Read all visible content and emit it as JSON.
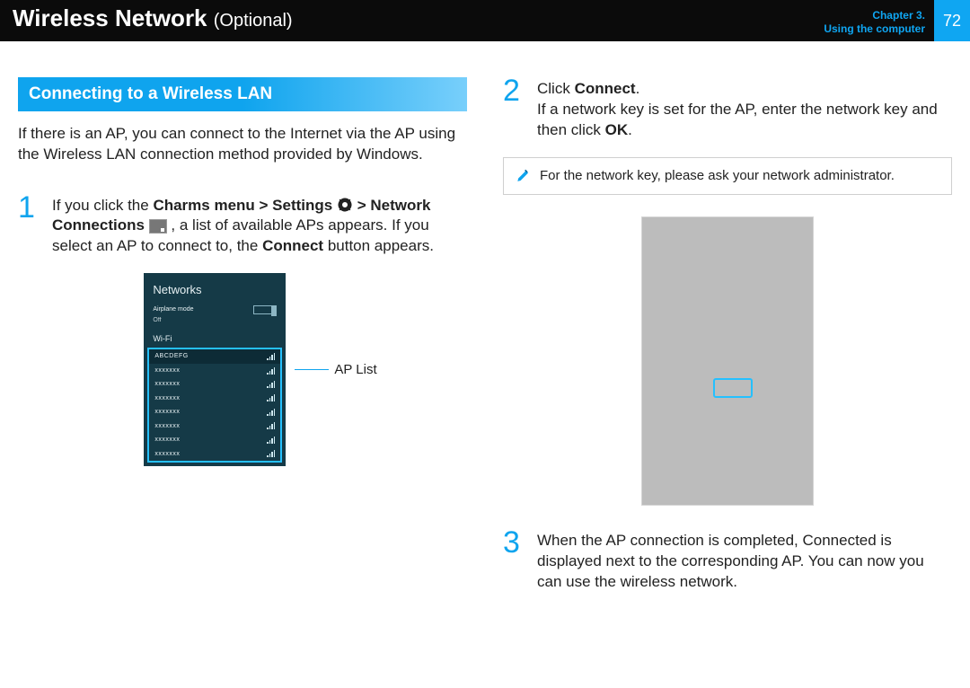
{
  "header": {
    "title_strong": "Wireless Network",
    "title_tag": "(Optional)",
    "chapter_line1": "Chapter 3.",
    "chapter_line2": "Using the computer",
    "page_number": "72"
  },
  "left": {
    "section_heading": "Connecting to a Wireless LAN",
    "intro": "If there is an AP, you can connect to the Internet via the AP using the Wireless LAN connection method provided by Windows.",
    "step1": {
      "num": "1",
      "text_a": "If you click the ",
      "bold_a": "Charms menu > Settings",
      "settings_icon_name": "settings-gear-icon",
      "bold_b": " > Network Connections",
      "netconn_icon_name": "network-connections-icon",
      "text_b": " , a list of available APs appears. If you select an AP to connect to, the ",
      "bold_c": "Connect",
      "text_c": " button appears."
    },
    "panel": {
      "title": "Networks",
      "airplane_label": "Airplane mode",
      "airplane_state": "Off",
      "wifi_label": "Wi-Fi",
      "aps": [
        {
          "name": "ABCDEFG",
          "selected": true
        },
        {
          "name": "xxxxxxx"
        },
        {
          "name": "xxxxxxx"
        },
        {
          "name": "xxxxxxx"
        },
        {
          "name": "xxxxxxx"
        },
        {
          "name": "xxxxxxx"
        },
        {
          "name": "xxxxxxx"
        },
        {
          "name": "xxxxxxx"
        }
      ],
      "callout_label": "AP List"
    }
  },
  "right": {
    "step2": {
      "num": "2",
      "line1_a": "Click ",
      "line1_b": "Connect",
      "line1_c": ".",
      "line2_a": "If a network key is set for the AP, enter the network key and then click ",
      "line2_b": "OK",
      "line2_c": "."
    },
    "note": "For the network key, please ask your network administrator.",
    "step3": {
      "num": "3",
      "text": "When the AP connection is completed, Connected is displayed next to the corresponding AP. You can now you can use the wireless network."
    }
  }
}
